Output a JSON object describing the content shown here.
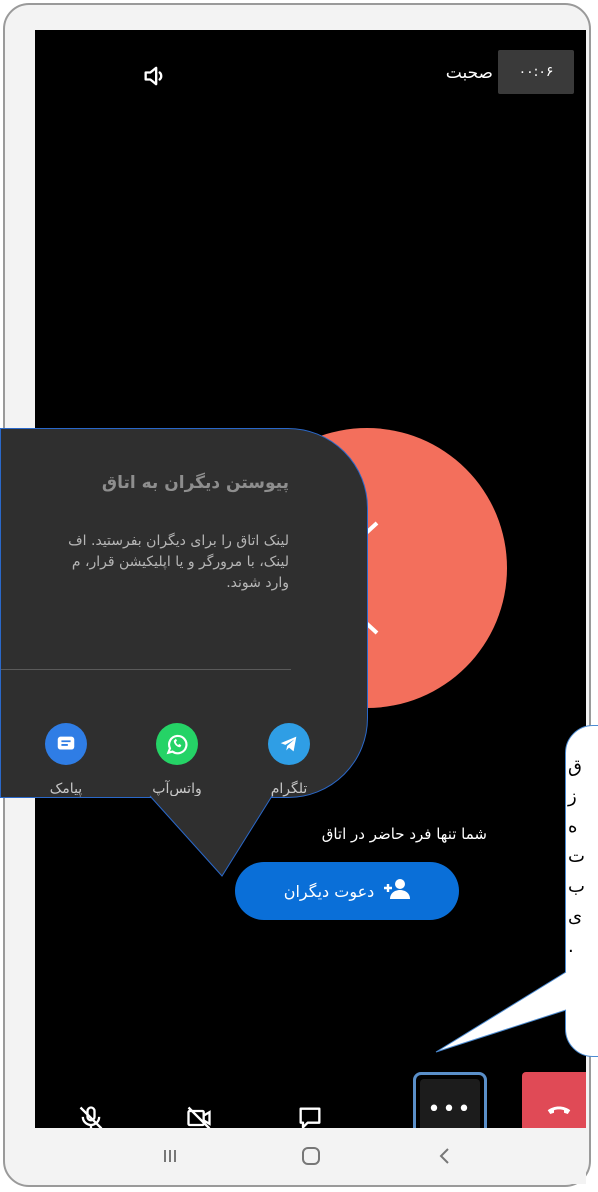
{
  "call": {
    "timer": "۰۰:۰۶",
    "room_title": "صحبت",
    "alone_text": "شما تنها فرد حاضر در اتاق",
    "invite_label": "دعوت دیگران"
  },
  "popup": {
    "title": "پیوستن دیگران به اتاق",
    "desc_lines": [
      "لینک اتاق را برای دیگران بفرستید. اف",
      "لینک، با مرورگر و یا اپلیکیشن قرار، م",
      "وارد شوند."
    ],
    "shares": [
      {
        "label": "تلگرام",
        "icon": "telegram-icon",
        "color": "#2f9ee5"
      },
      {
        "label": "واتس‌آپ",
        "icon": "whatsapp-icon",
        "color": "#25d366"
      },
      {
        "label": "پیامک",
        "icon": "sms-icon",
        "color": "#2f7de5"
      }
    ]
  },
  "callout": {
    "lines": [
      "ق",
      "ز",
      "ه",
      "ت",
      "ب",
      "ی",
      "."
    ]
  },
  "toolbar": {
    "more_label": "•••",
    "icons": [
      "mic-off-icon",
      "camera-off-icon",
      "chat-icon",
      "more-icon",
      "hangup-icon"
    ]
  },
  "nav": {
    "icons": [
      "recents-icon",
      "home-icon",
      "back-icon"
    ]
  },
  "colors": {
    "accent": "#0a6fd8",
    "avatar": "#f36f5c",
    "hangup": "#e04a56",
    "highlight": "#5a8fc9"
  }
}
